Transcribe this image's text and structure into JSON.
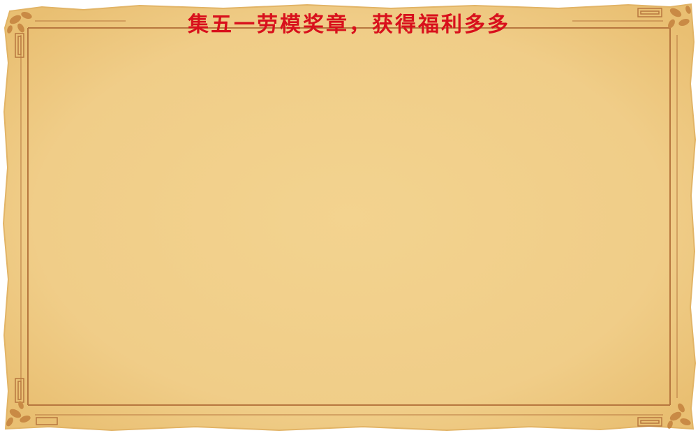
{
  "panel": {
    "title": "集五一劳模奖章，获得福利多多"
  },
  "colors": {
    "parchment": "#f1d08e",
    "parchment_edge": "#e6b96a",
    "border_line": "#b7773f",
    "leaf": "#c98a45",
    "title": "#d8101c"
  }
}
